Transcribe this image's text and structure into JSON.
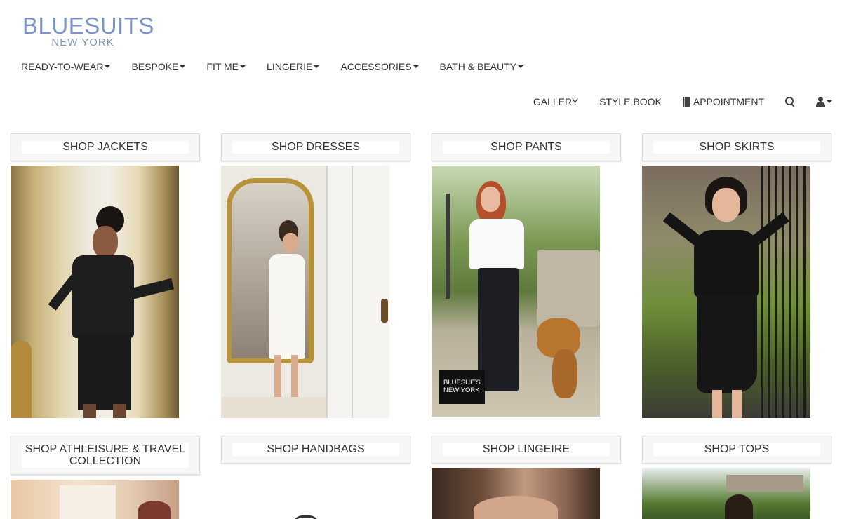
{
  "logo": {
    "brand": "BLUESUITS",
    "city": "NEW YORK"
  },
  "primary_nav": [
    {
      "label": "READY-TO-WEAR"
    },
    {
      "label": "BESPOKE"
    },
    {
      "label": "FIT ME"
    },
    {
      "label": "LINGERIE"
    },
    {
      "label": "ACCESSORIES"
    },
    {
      "label": "BATH & BEAUTY"
    }
  ],
  "secondary_nav": {
    "gallery": "GALLERY",
    "style_book": "STYLE BOOK",
    "appointment": "APPOINTMENT",
    "search_icon": "search-icon",
    "user_icon": "user-icon"
  },
  "products": [
    {
      "label": "SHOP JACKETS"
    },
    {
      "label": "SHOP DRESSES"
    },
    {
      "label": "SHOP PANTS",
      "badge_line1": "BLUESUITS",
      "badge_line2": "NEW YORK"
    },
    {
      "label": "SHOP SKIRTS"
    },
    {
      "label": "SHOP ATHLEISURE & TRAVEL COLLECTION"
    },
    {
      "label": "SHOP HANDBAGS"
    },
    {
      "label": "SHOP LINGEIRE"
    },
    {
      "label": "SHOP TOPS"
    }
  ],
  "colors": {
    "brand": "#7d94c6",
    "text": "#333333",
    "label_bg": "#f6f6f6"
  }
}
